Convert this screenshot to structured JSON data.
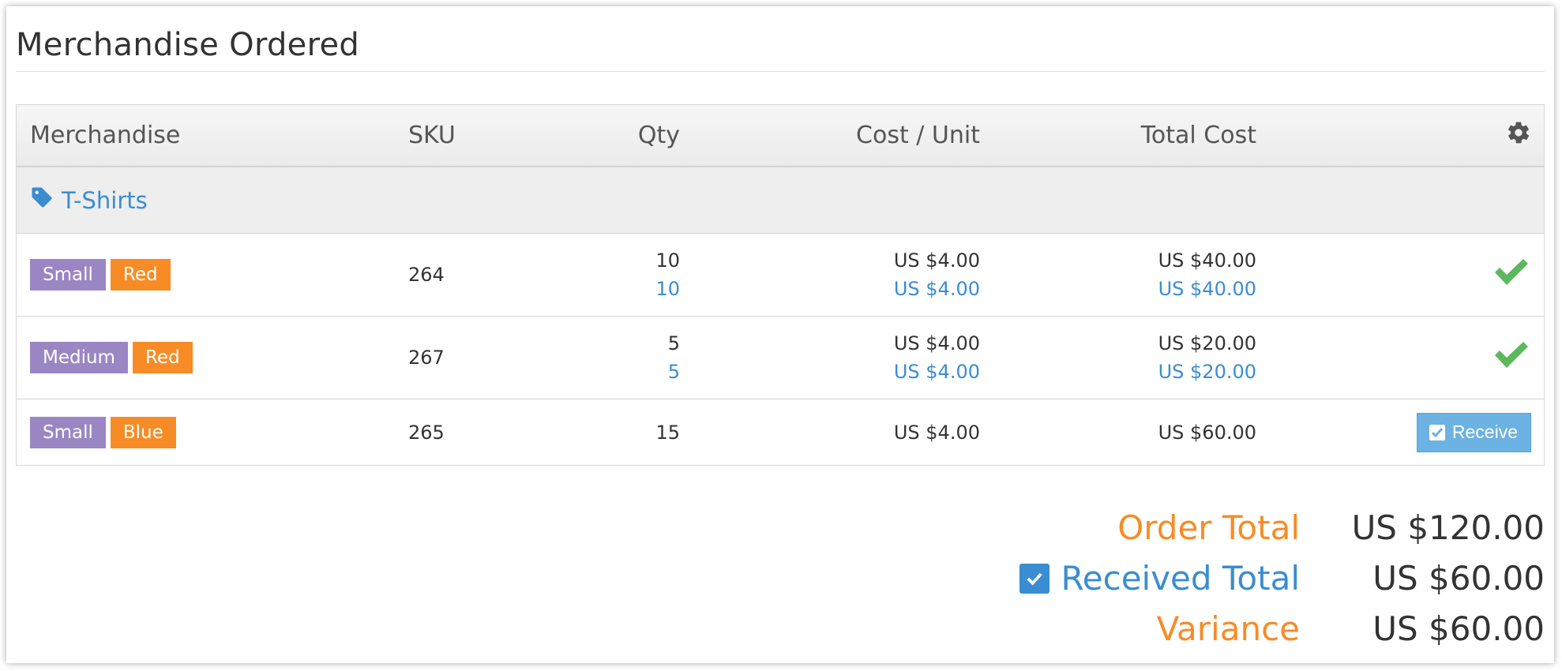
{
  "page": {
    "title": "Merchandise Ordered"
  },
  "table": {
    "headers": {
      "merchandise": "Merchandise",
      "sku": "SKU",
      "qty": "Qty",
      "cost_unit": "Cost / Unit",
      "total_cost": "Total Cost",
      "settings_icon": "gear-icon"
    },
    "group": {
      "label": "T-Shirts",
      "icon": "tag-icon"
    },
    "rows": [
      {
        "size": "Small",
        "color": "Red",
        "sku": "264",
        "qty_ordered": "10",
        "qty_received": "10",
        "cost_ordered": "US $4.00",
        "cost_received": "US $4.00",
        "total_ordered": "US $40.00",
        "total_received": "US $40.00",
        "status_icon": "check-icon"
      },
      {
        "size": "Medium",
        "color": "Red",
        "sku": "267",
        "qty_ordered": "5",
        "qty_received": "5",
        "cost_ordered": "US $4.00",
        "cost_received": "US $4.00",
        "total_ordered": "US $20.00",
        "total_received": "US $20.00",
        "status_icon": "check-icon"
      },
      {
        "size": "Small",
        "color": "Blue",
        "sku": "265",
        "qty_ordered": "15",
        "cost_ordered": "US $4.00",
        "total_ordered": "US $60.00",
        "action_label": "Receive"
      }
    ]
  },
  "totals": {
    "order_total_label": "Order Total",
    "order_total_value": "US $120.00",
    "received_total_label": "Received Total",
    "received_total_value": "US $60.00",
    "variance_label": "Variance",
    "variance_value": "US $60.00"
  },
  "colors": {
    "accent_blue": "#3a8dd0",
    "accent_orange": "#f78c26",
    "size_badge": "#9b86c4",
    "success_green": "#5cb85c",
    "receive_button": "#6cb2e3"
  }
}
